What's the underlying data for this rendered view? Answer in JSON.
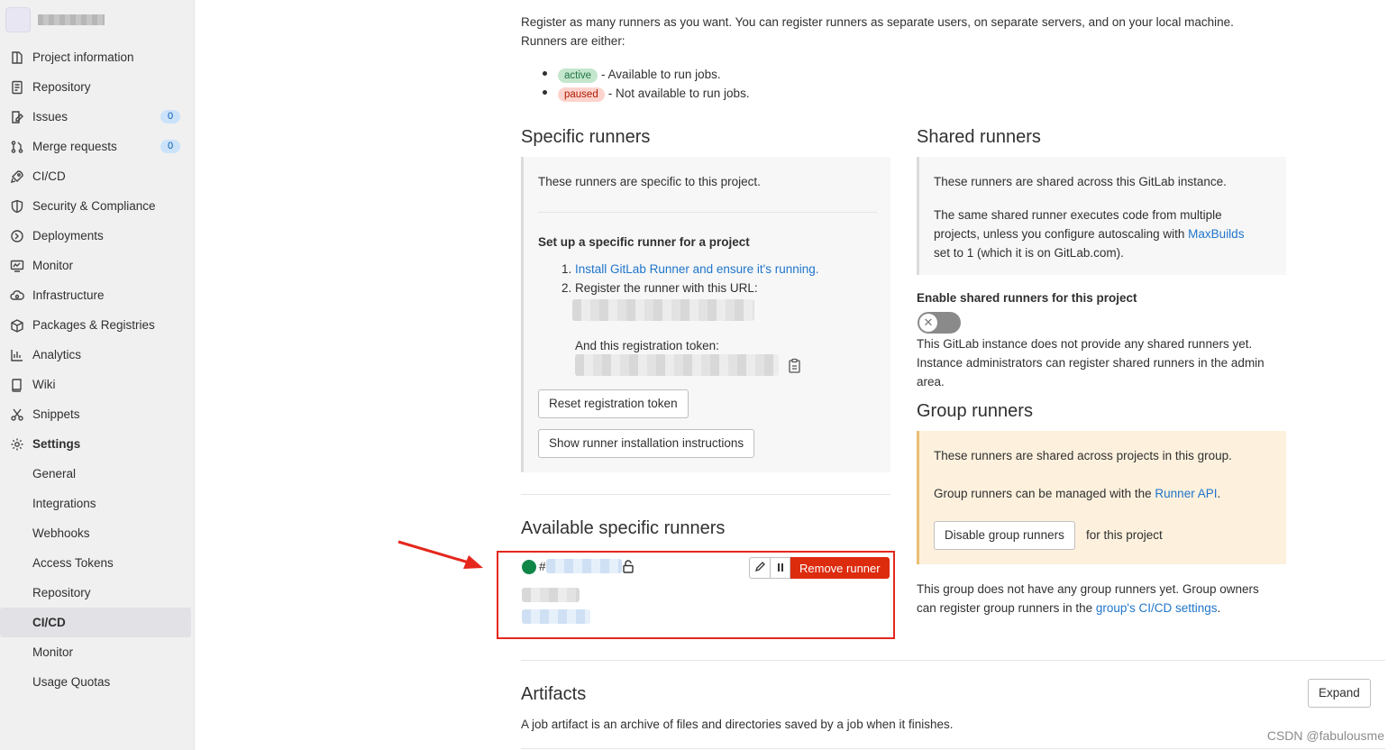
{
  "sidebar": {
    "items": [
      {
        "label": "Project information",
        "icon": "info-icon"
      },
      {
        "label": "Repository",
        "icon": "doc-icon"
      },
      {
        "label": "Issues",
        "icon": "issues-icon",
        "count": "0"
      },
      {
        "label": "Merge requests",
        "icon": "merge-icon",
        "count": "0"
      },
      {
        "label": "CI/CD",
        "icon": "rocket-icon"
      },
      {
        "label": "Security & Compliance",
        "icon": "shield-icon"
      },
      {
        "label": "Deployments",
        "icon": "deploy-icon"
      },
      {
        "label": "Monitor",
        "icon": "monitor-icon"
      },
      {
        "label": "Infrastructure",
        "icon": "cloud-icon"
      },
      {
        "label": "Packages & Registries",
        "icon": "package-icon"
      },
      {
        "label": "Analytics",
        "icon": "chart-icon"
      },
      {
        "label": "Wiki",
        "icon": "book-icon"
      },
      {
        "label": "Snippets",
        "icon": "scissors-icon"
      },
      {
        "label": "Settings",
        "icon": "gear-icon"
      }
    ],
    "settings_sub": [
      "General",
      "Integrations",
      "Webhooks",
      "Access Tokens",
      "Repository",
      "CI/CD",
      "Monitor",
      "Usage Quotas"
    ]
  },
  "intro": {
    "line1": "Register as many runners as you want. You can register runners as separate users, on separate servers, and on your local machine.",
    "line2": "Runners are either:",
    "active_pill": "active",
    "active_desc": "- Available to run jobs.",
    "paused_pill": "paused",
    "paused_desc": "- Not available to run jobs."
  },
  "specific": {
    "title": "Specific runners",
    "desc": "These runners are specific to this project.",
    "setup_title": "Set up a specific runner for a project",
    "step1_num": "1.",
    "step1_link": "Install GitLab Runner and ensure it's running.",
    "step2_num": "2.",
    "step2": "Register the runner with this URL:",
    "token_label": "And this registration token:",
    "reset_btn": "Reset registration token",
    "show_btn": "Show runner installation instructions"
  },
  "available": {
    "title": "Available specific runners",
    "hash": "#",
    "remove_btn": "Remove runner"
  },
  "shared": {
    "title": "Shared runners",
    "desc1": "These runners are shared across this GitLab instance.",
    "desc2a": "The same shared runner executes code from multiple",
    "desc2b": "projects, unless you configure autoscaling with",
    "maxbuilds": "MaxBuilds",
    "desc2c": "set to 1 (which it is on GitLab.com).",
    "enable_label": "Enable shared runners for this project",
    "none1": "This GitLab instance does not provide any shared runners yet.",
    "none2": "Instance administrators can register shared runners in the admin",
    "none3": "area."
  },
  "group": {
    "title": "Group runners",
    "desc1": "These runners are shared across projects in this group.",
    "desc2": "Group runners can be managed with the",
    "api_link": "Runner API",
    "desc2_end": ".",
    "disable_btn": "Disable group runners",
    "for_project": "for this project",
    "none1": "This group does not have any group runners yet. Group owners",
    "none2a": "can register group runners in the",
    "none2_link": "group's CI/CD settings",
    "none2_end": "."
  },
  "artifacts": {
    "title": "Artifacts",
    "desc": "A job artifact is an archive of files and directories saved by a job when it finishes.",
    "expand_btn": "Expand"
  },
  "watermark": "CSDN @fabulousme",
  "colors": {
    "accent": "#1f75cb",
    "danger": "#dd2b0e",
    "annotation": "#e5271d"
  }
}
